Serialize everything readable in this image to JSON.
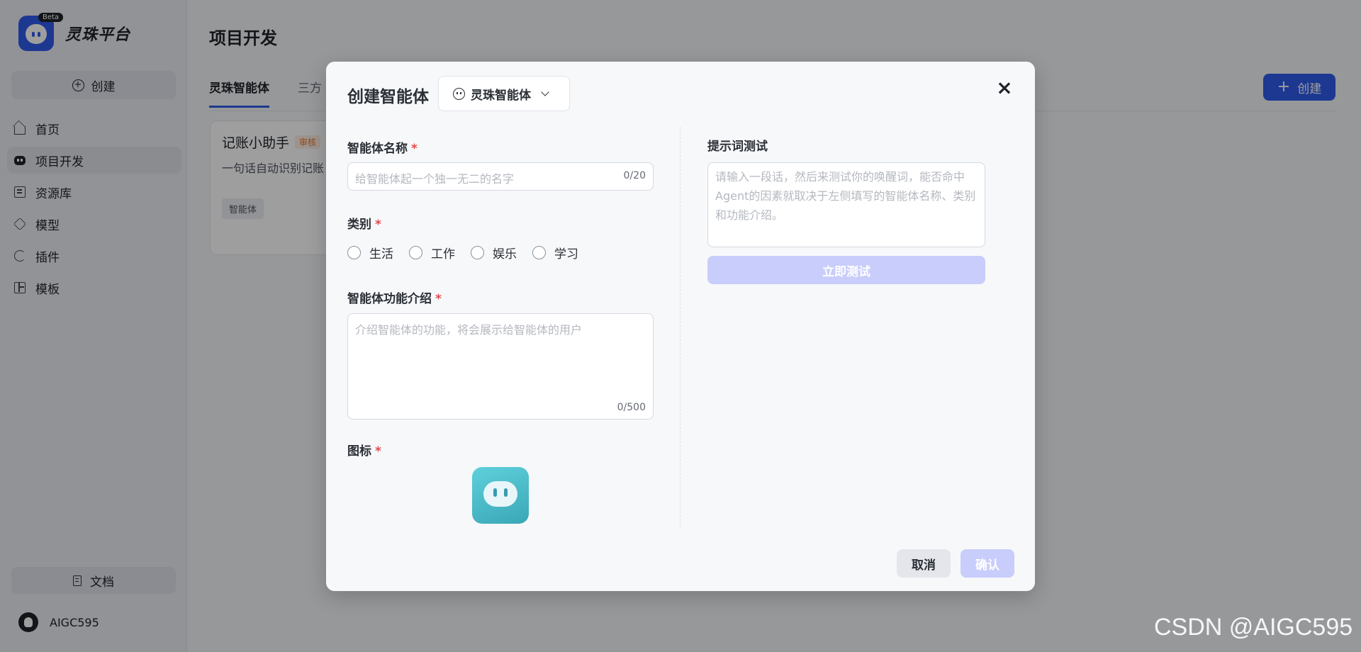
{
  "sidebar": {
    "logo_text": "灵珠平台",
    "beta_badge": "Beta",
    "create_label": "创建",
    "items": [
      {
        "label": "首页",
        "icon": "home-icon"
      },
      {
        "label": "项目开发",
        "icon": "robot-icon"
      },
      {
        "label": "资源库",
        "icon": "library-icon"
      },
      {
        "label": "模型",
        "icon": "model-icon"
      },
      {
        "label": "插件",
        "icon": "plugin-icon"
      },
      {
        "label": "模板",
        "icon": "template-icon"
      }
    ],
    "docs_label": "文档",
    "username": "AIGC595"
  },
  "main": {
    "title": "项目开发",
    "tabs": [
      "灵珠智能体",
      "三方"
    ],
    "create_label": "创建",
    "card": {
      "title": "记账小助手",
      "badge": "审核",
      "desc": "一句话自动识别记账",
      "tag": "智能体"
    }
  },
  "modal": {
    "title": "创建智能体",
    "type_select": "灵珠智能体",
    "name": {
      "label": "智能体名称",
      "required": "*",
      "placeholder": "给智能体起一个独一无二的名字",
      "counter": "0/20"
    },
    "category": {
      "label": "类别",
      "required": "*",
      "options": [
        "生活",
        "工作",
        "娱乐",
        "学习"
      ]
    },
    "desc": {
      "label": "智能体功能介绍",
      "required": "*",
      "placeholder": "介绍智能体的功能，将会展示给智能体的用户",
      "counter": "0/500"
    },
    "icon": {
      "label": "图标",
      "required": "*"
    },
    "prompt_test": {
      "label": "提示词测试",
      "placeholder": "请输入一段话，然后来测试你的唤醒词，能否命中Agent的因素就取决于左侧填写的智能体名称、类别和功能介绍。",
      "button": "立即测试"
    },
    "cancel_label": "取消",
    "confirm_label": "确认"
  },
  "watermark": "CSDN @AIGC595",
  "colors": {
    "accent": "#2f5bea",
    "disabled_accent": "#c9cdfb",
    "required": "#e5484d"
  }
}
